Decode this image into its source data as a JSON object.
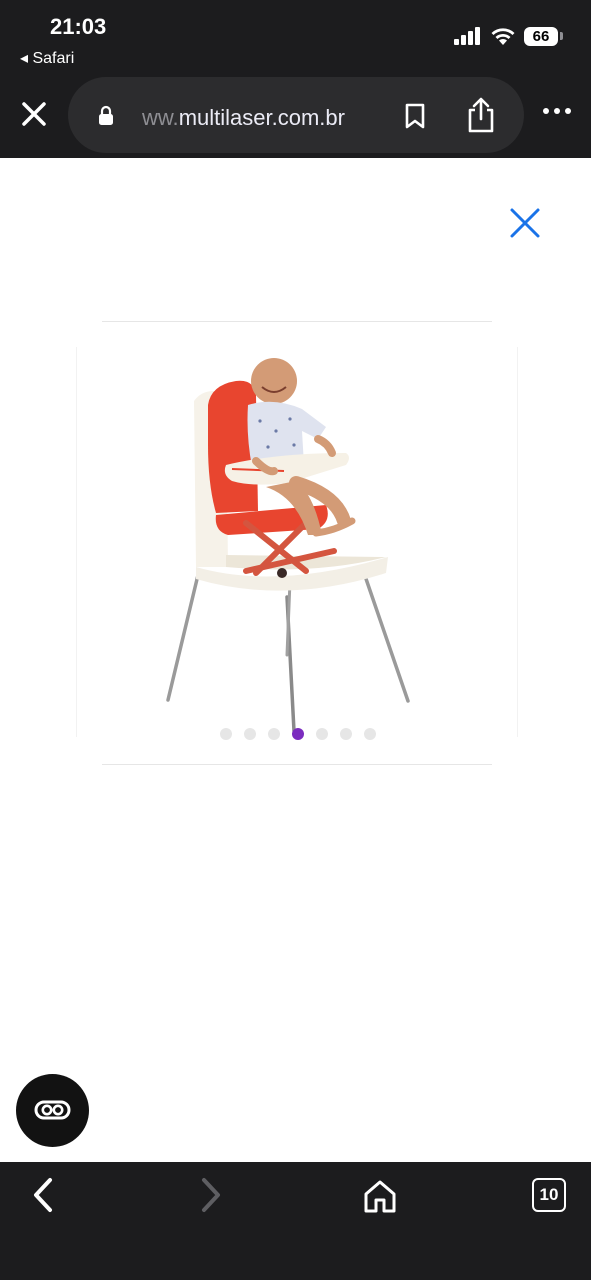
{
  "status": {
    "time": "21:03",
    "back_app": "◂ Safari",
    "battery": "66"
  },
  "browser": {
    "url_prefix": "ww.",
    "url_main": "multilaser.com.br",
    "tab_count": "10"
  },
  "carousel": {
    "total": 7,
    "active_index": 3
  },
  "colors": {
    "accent_close": "#1a73e8",
    "active_dot": "#7b2cbf",
    "chair_red": "#e8452f"
  }
}
